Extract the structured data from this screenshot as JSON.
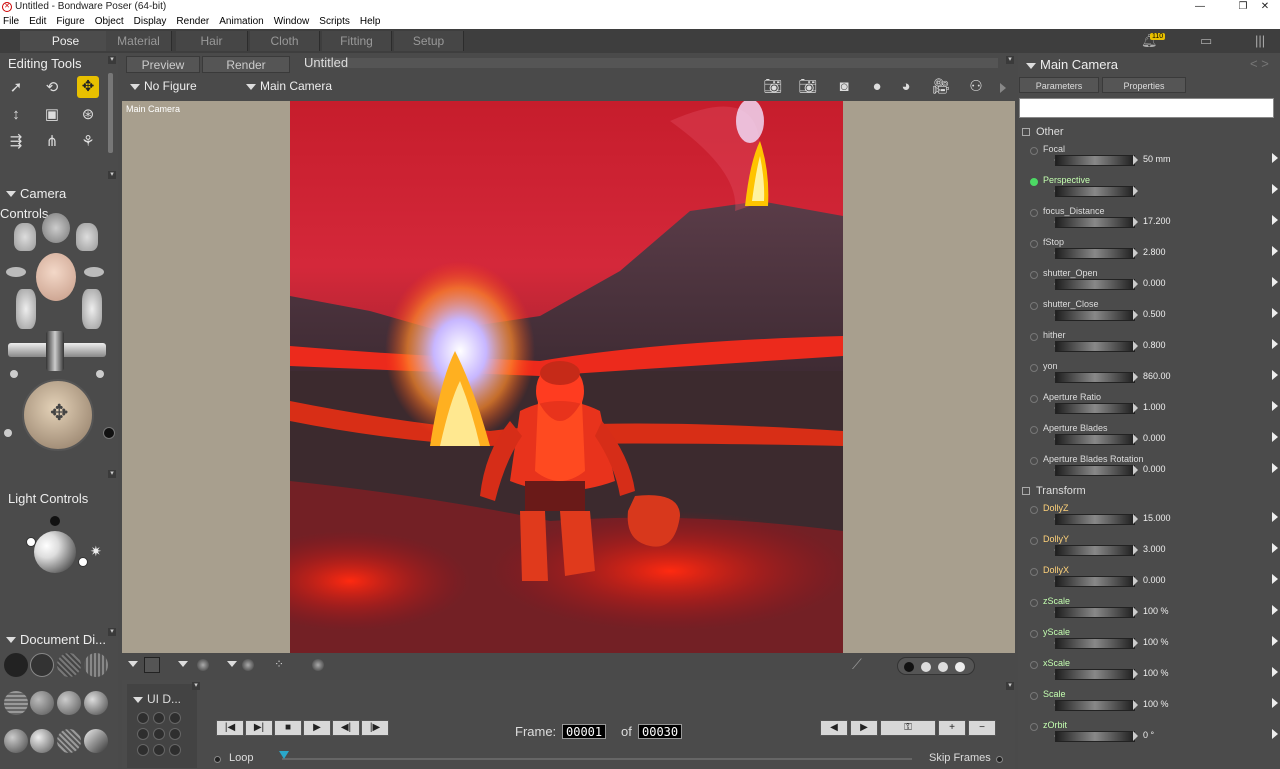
{
  "window": {
    "title": "Untitled - Bondware Poser (64-bit)"
  },
  "menu": [
    "File",
    "Edit",
    "Figure",
    "Object",
    "Display",
    "Render",
    "Animation",
    "Window",
    "Scripts",
    "Help"
  ],
  "top_tabs": [
    "Pose",
    "Material",
    "Hair",
    "Cloth",
    "Fitting",
    "Setup"
  ],
  "notification_count": "110",
  "left": {
    "editing_tools": "Editing Tools",
    "camera_controls": "Camera Controls",
    "light_controls": "Light Controls",
    "document_display": "Document Di...",
    "ui_dots": "UI D..."
  },
  "viewport": {
    "tabs": {
      "preview": "Preview",
      "render": "Render",
      "doc": "Untitled"
    },
    "figure_dropdown": "No Figure",
    "camera_dropdown": "Main Camera",
    "camera_label": "Main Camera"
  },
  "timeline": {
    "frame_label": "Frame:",
    "current_frame": "00001",
    "of": "of",
    "total_frames": "00030",
    "loop": "Loop",
    "skip_frames": "Skip Frames"
  },
  "right": {
    "title": "Main Camera",
    "tabs": [
      "Parameters",
      "Properties"
    ],
    "group_other": "Other",
    "group_transform": "Transform",
    "params": [
      {
        "name": "Focal",
        "value": "50 mm"
      },
      {
        "name": "Perspective",
        "value": ""
      },
      {
        "name": "focus_Distance",
        "value": "17.200"
      },
      {
        "name": "fStop",
        "value": "2.800"
      },
      {
        "name": "shutter_Open",
        "value": "0.000"
      },
      {
        "name": "shutter_Close",
        "value": "0.500"
      },
      {
        "name": "hither",
        "value": "0.800"
      },
      {
        "name": "yon",
        "value": "860.00"
      },
      {
        "name": "Aperture Ratio",
        "value": "1.000"
      },
      {
        "name": "Aperture Blades",
        "value": "0.000"
      },
      {
        "name": "Aperture Blades Rotation",
        "value": "0.000"
      }
    ],
    "transform": [
      {
        "name": "DollyZ",
        "value": "15.000"
      },
      {
        "name": "DollyY",
        "value": "3.000"
      },
      {
        "name": "DollyX",
        "value": "0.000"
      },
      {
        "name": "zScale",
        "value": "100 %"
      },
      {
        "name": "yScale",
        "value": "100 %"
      },
      {
        "name": "xScale",
        "value": "100 %"
      },
      {
        "name": "Scale",
        "value": "100 %"
      },
      {
        "name": "zOrbit",
        "value": "0 °"
      }
    ]
  },
  "colors": {
    "accent": "#e8c000",
    "active_dot": "#4cd964"
  }
}
